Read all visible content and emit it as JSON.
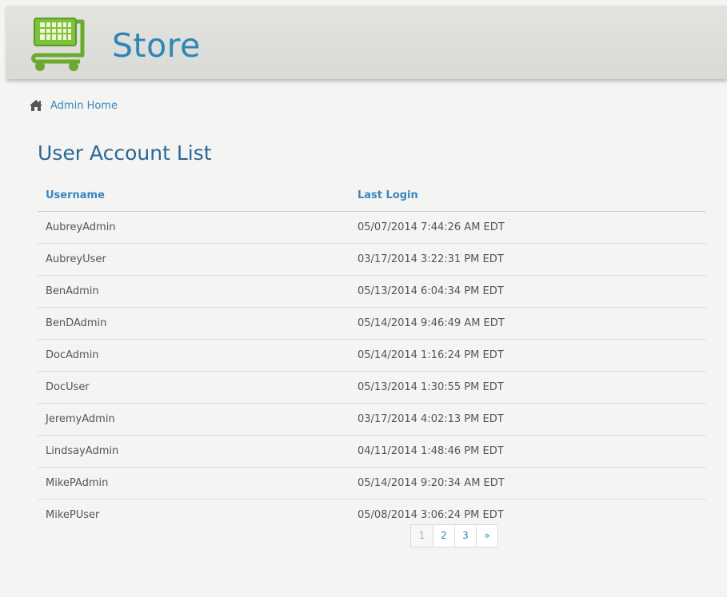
{
  "header": {
    "brand": "Store"
  },
  "breadcrumb": {
    "home_label": "Admin Home"
  },
  "page": {
    "title": "User Account List"
  },
  "table": {
    "columns": [
      "Username",
      "Last Login"
    ],
    "rows": [
      {
        "username": "AubreyAdmin",
        "last_login": "05/07/2014 7:44:26 AM EDT"
      },
      {
        "username": "AubreyUser",
        "last_login": "03/17/2014 3:22:31 PM EDT"
      },
      {
        "username": "BenAdmin",
        "last_login": "05/13/2014 6:04:34 PM EDT"
      },
      {
        "username": "BenDAdmin",
        "last_login": "05/14/2014 9:46:49 AM EDT"
      },
      {
        "username": "DocAdmin",
        "last_login": "05/14/2014 1:16:24 PM EDT"
      },
      {
        "username": "DocUser",
        "last_login": "05/13/2014 1:30:55 PM EDT"
      },
      {
        "username": "JeremyAdmin",
        "last_login": "03/17/2014 4:02:13 PM EDT"
      },
      {
        "username": "LindsayAdmin",
        "last_login": "04/11/2014 1:48:46 PM EDT"
      },
      {
        "username": "MikePAdmin",
        "last_login": "05/14/2014 9:20:34 AM EDT"
      },
      {
        "username": "MikePUser",
        "last_login": "05/08/2014 3:06:24 PM EDT"
      }
    ]
  },
  "pagination": {
    "pages": [
      "1",
      "2",
      "3"
    ],
    "next": "»",
    "current": "1"
  },
  "icons": {
    "logo": "shopping-cart-icon",
    "home": "home-icon"
  },
  "colors": {
    "accent": "#2d86b8",
    "logo_green": "#6aab2e",
    "title_blue": "#2a6896"
  }
}
